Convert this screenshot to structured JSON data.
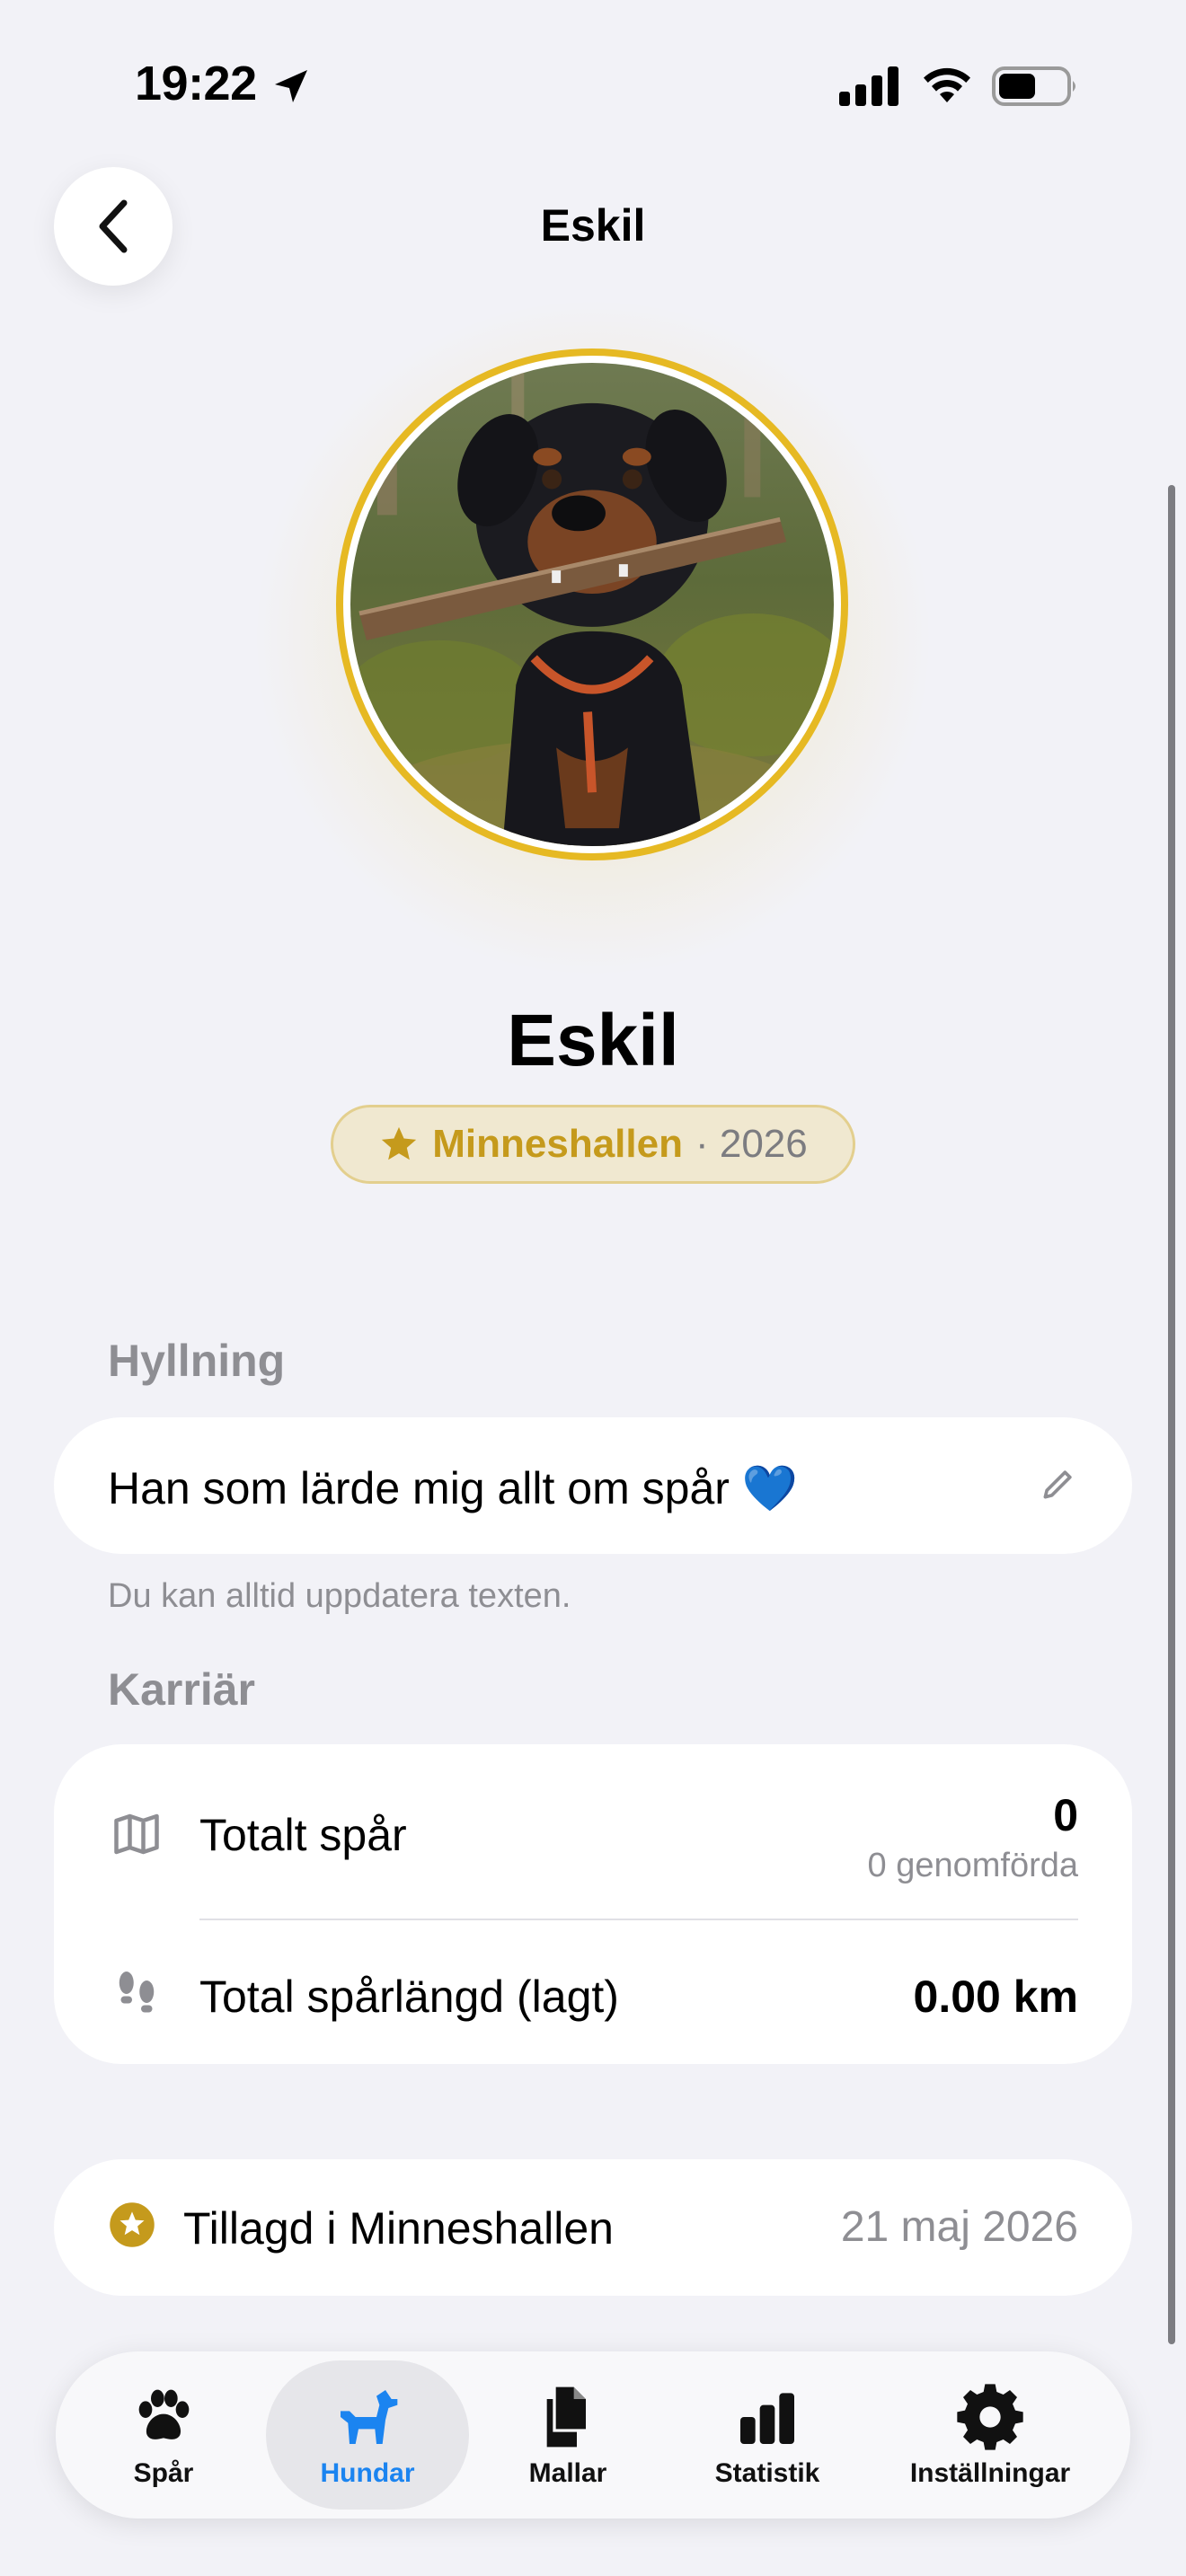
{
  "status_bar": {
    "time": "19:22"
  },
  "nav": {
    "title": "Eskil",
    "back_icon": "chevron-left-icon"
  },
  "profile": {
    "name": "Eskil",
    "badge": {
      "icon": "star-icon",
      "label": "Minneshallen",
      "year": "· 2026"
    }
  },
  "tribute": {
    "header": "Hyllning",
    "text": "Han som lärde mig allt om spår 💙",
    "footnote": "Du kan alltid uppdatera texten."
  },
  "career": {
    "header": "Karriär",
    "rows": [
      {
        "icon": "map-icon",
        "label": "Totalt spår",
        "value": "0",
        "sub": "0 genomförda"
      },
      {
        "icon": "footprints-icon",
        "label": "Total spårlängd (lagt)",
        "value": "0.00 km"
      }
    ]
  },
  "memorial": {
    "icon": "star-circle-icon",
    "label": "Tillagd i Minneshallen",
    "date": "21 maj 2026"
  },
  "tabs": [
    {
      "label": "Spår",
      "icon": "paw-icon",
      "active": false
    },
    {
      "label": "Hundar",
      "icon": "dog-icon",
      "active": true
    },
    {
      "label": "Mallar",
      "icon": "documents-icon",
      "active": false
    },
    {
      "label": "Statistik",
      "icon": "bar-chart-icon",
      "active": false
    },
    {
      "label": "Inställningar",
      "icon": "gear-icon",
      "active": false
    }
  ],
  "colors": {
    "accent": "#1b84f0",
    "gold": "#c59a1c",
    "background": "#f2f2f7"
  }
}
